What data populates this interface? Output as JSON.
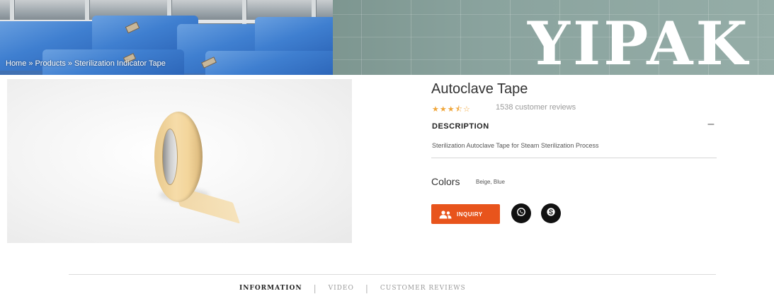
{
  "banner": {
    "brand": "YIPAK",
    "breadcrumb": {
      "home": "Home",
      "products": "Products",
      "current": "Sterilization Indicator Tape",
      "separator": "»"
    }
  },
  "product": {
    "title": "Autoclave Tape",
    "rating": {
      "stars": 3.5,
      "max": 5,
      "display": "★★★⯪☆"
    },
    "reviews_text": "1538 customer reviews",
    "description_heading": "DESCRIPTION",
    "description_toggle": "–",
    "description_body": "Sterilization Autoclave Tape for Steam Sterilization Process",
    "colors_label": "Colors",
    "colors_value": "Beige, Blue"
  },
  "actions": {
    "inquiry_label": "INQUIRY",
    "inquiry_icon": "users-icon",
    "whatsapp_icon": "whatsapp-icon",
    "skype_icon": "skype-icon",
    "accent_color": "#e8541c"
  },
  "tabs": [
    {
      "label": "INFORMATION",
      "active": true
    },
    {
      "label": "VIDEO",
      "active": false
    },
    {
      "label": "CUSTOMER REVIEWS",
      "active": false
    }
  ],
  "tab_separator": "|"
}
